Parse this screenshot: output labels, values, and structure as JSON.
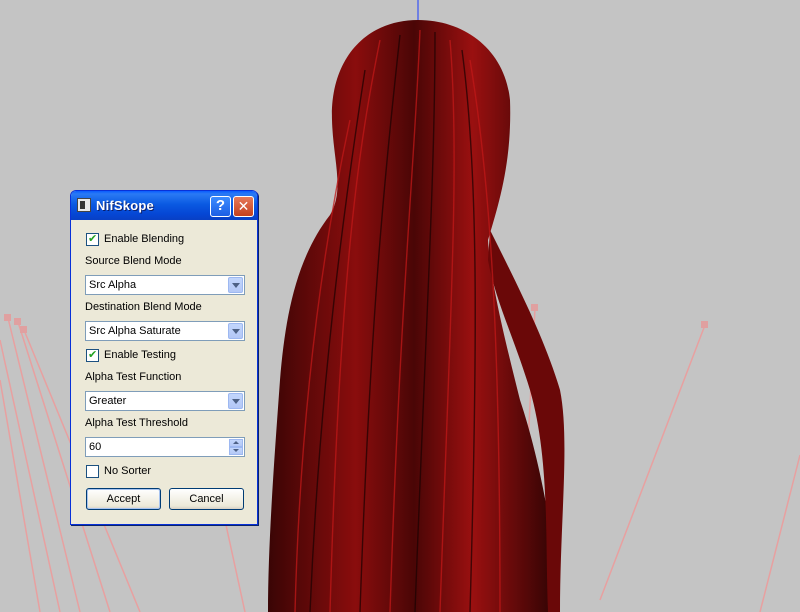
{
  "dialog": {
    "title": "NifSkope",
    "help_glyph": "?",
    "close_glyph": "✕",
    "enable_blending": {
      "label": "Enable Blending",
      "checked": true
    },
    "source_blend": {
      "label": "Source Blend Mode",
      "value": "Src Alpha"
    },
    "destination_blend": {
      "label": "Destination Blend Mode",
      "value": "Src Alpha Saturate"
    },
    "enable_testing": {
      "label": "Enable Testing",
      "checked": true
    },
    "alpha_test_function": {
      "label": "Alpha Test Function",
      "value": "Greater"
    },
    "alpha_test_threshold": {
      "label": "Alpha Test Threshold",
      "value": "60"
    },
    "no_sorter": {
      "label": "No Sorter",
      "checked": false
    },
    "accept_label": "Accept",
    "cancel_label": "Cancel",
    "check_glyph": "✔"
  },
  "viewport": {
    "background_color": "#c4c4c4",
    "hair_color": "#8a0d0d",
    "bone_line_color": "#e8a0a0"
  },
  "icons": {
    "app": "nifskope-app-icon",
    "help": "help-icon",
    "close": "close-icon",
    "combo_arrow": "chevron-down-icon",
    "spin_up": "spin-up-icon",
    "spin_down": "spin-down-icon"
  }
}
